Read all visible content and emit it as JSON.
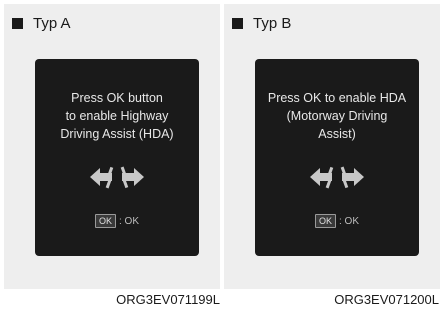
{
  "panels": [
    {
      "title": "Typ A",
      "message": "Press OK button to enable Highway Driving Assist (HDA)",
      "message_lines": [
        "Press OK button",
        "to enable Highway",
        "Driving Assist (HDA)"
      ],
      "ok_key": "OK",
      "ok_text": ": OK",
      "reference": "ORG3EV071199L"
    },
    {
      "title": "Typ B",
      "message": "Press OK to enable HDA (Motorway Driving Assist)",
      "message_lines": [
        "Press OK to enable HDA",
        "(Motorway Driving",
        "Assist)"
      ],
      "ok_key": "OK",
      "ok_text": ": OK",
      "reference": "ORG3EV071200L"
    }
  ],
  "icons": {
    "bullet": "square-bullet-icon",
    "lane": "lane-merge-arrows-icon"
  },
  "colors": {
    "panel_bg": "#eeeeee",
    "screen_bg": "#1a1a1a",
    "screen_text": "#e8e8e8",
    "icon": "#c8c8c8"
  }
}
